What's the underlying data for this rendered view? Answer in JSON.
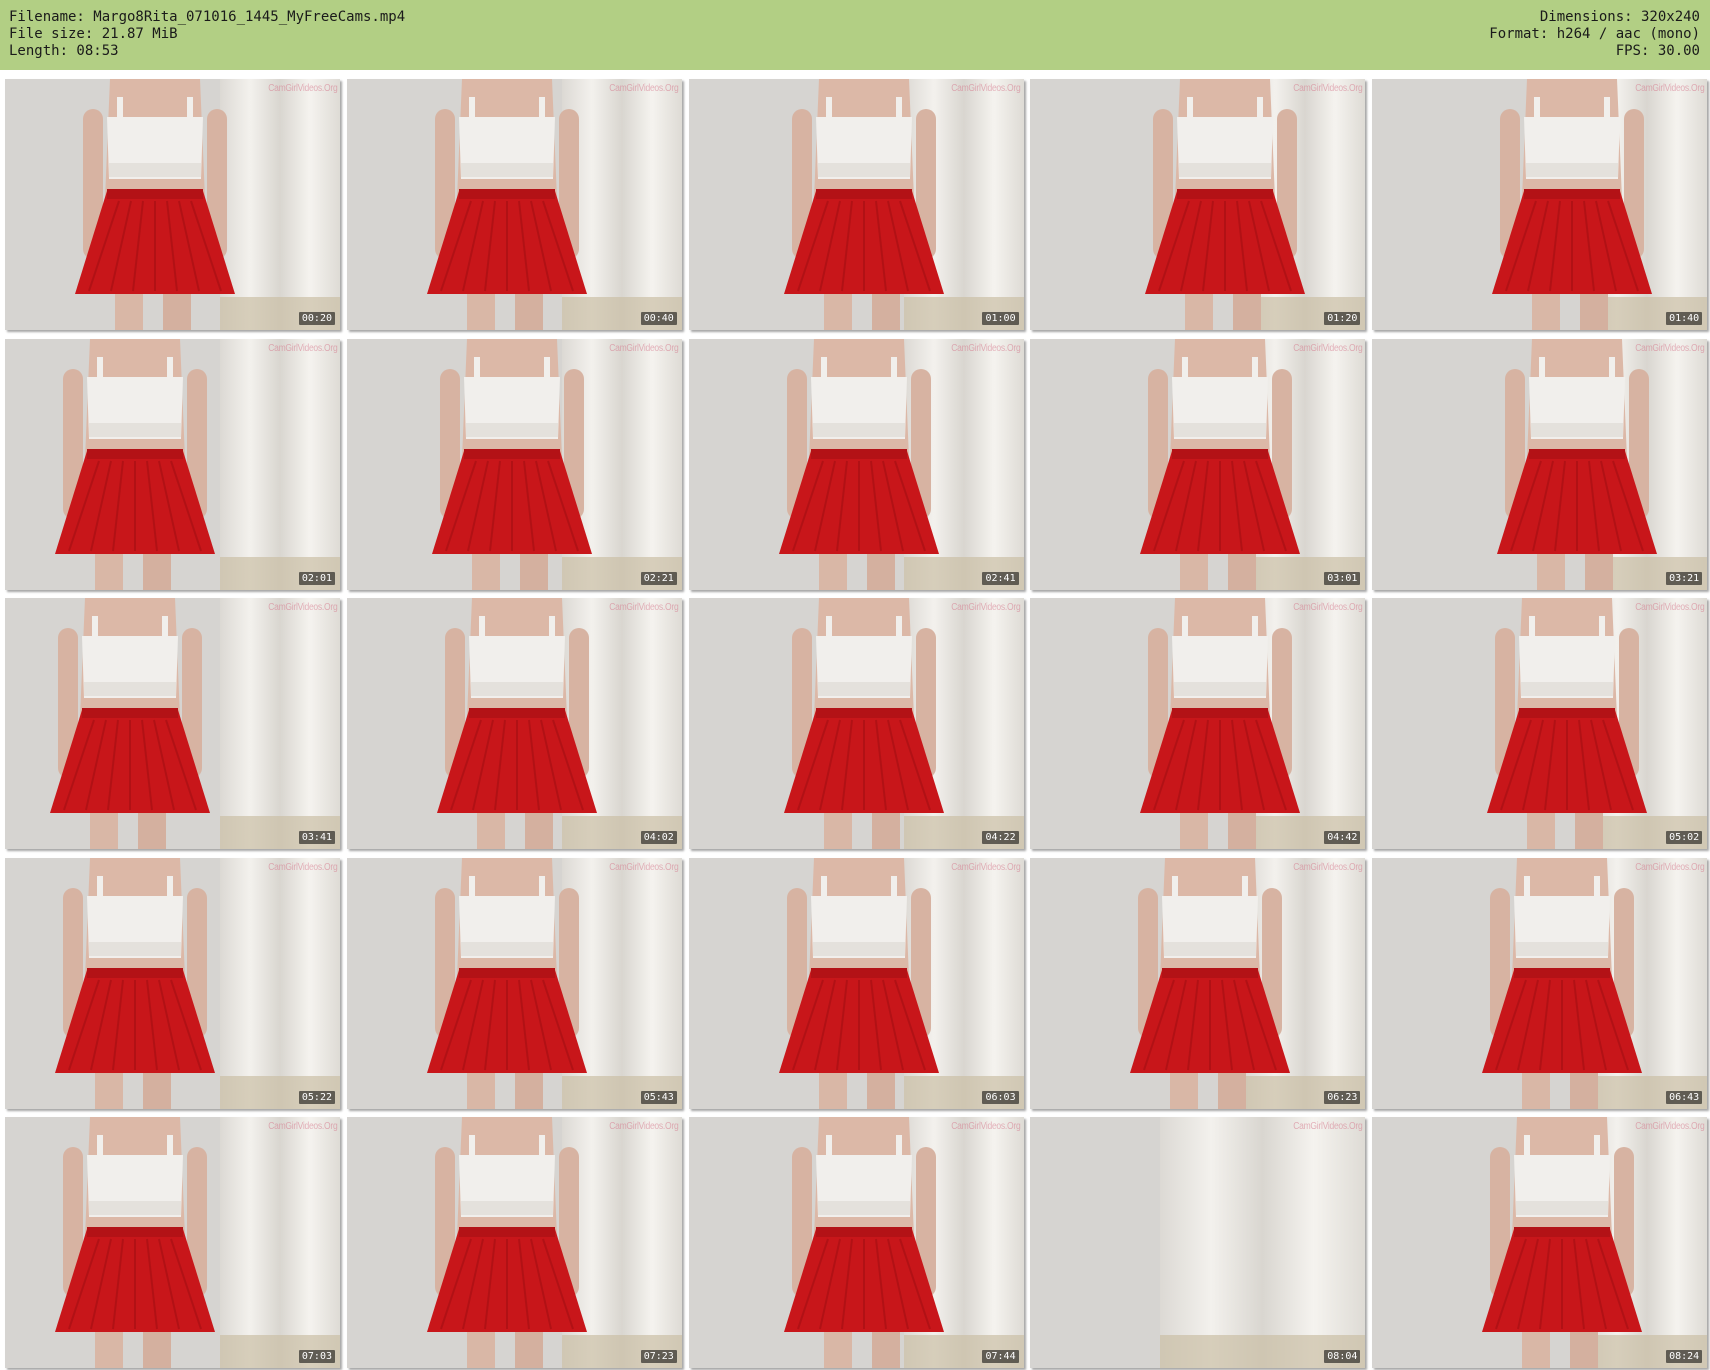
{
  "header": {
    "filename_line": "Filename: Margo8Rita_071016_1445_MyFreeCams.mp4",
    "filesize_line": "File size: 21.87 MiB",
    "length_line": "Length: 08:53",
    "dimensions_line": "Dimensions: 320x240",
    "format_line": "Format: h264 / aac (mono)",
    "fps_line": "FPS: 30.00"
  },
  "colors": {
    "header_bg": "#b2cf84",
    "skirt": "#c8161a",
    "top": "#f1efec",
    "wall": "#d6d4d1",
    "curtain": "#ece9e3"
  },
  "watermark": "CamGirlVideos.Org",
  "thumbnails": [
    {
      "time": "00:20",
      "pose": "person"
    },
    {
      "time": "00:40",
      "pose": "person"
    },
    {
      "time": "01:00",
      "pose": "person"
    },
    {
      "time": "01:20",
      "pose": "person"
    },
    {
      "time": "01:40",
      "pose": "person"
    },
    {
      "time": "02:01",
      "pose": "person"
    },
    {
      "time": "02:21",
      "pose": "person"
    },
    {
      "time": "02:41",
      "pose": "person"
    },
    {
      "time": "03:01",
      "pose": "person"
    },
    {
      "time": "03:21",
      "pose": "person"
    },
    {
      "time": "03:41",
      "pose": "person"
    },
    {
      "time": "04:02",
      "pose": "person"
    },
    {
      "time": "04:22",
      "pose": "person"
    },
    {
      "time": "04:42",
      "pose": "person"
    },
    {
      "time": "05:02",
      "pose": "person"
    },
    {
      "time": "05:22",
      "pose": "person"
    },
    {
      "time": "05:43",
      "pose": "person"
    },
    {
      "time": "06:03",
      "pose": "person"
    },
    {
      "time": "06:23",
      "pose": "person"
    },
    {
      "time": "06:43",
      "pose": "person"
    },
    {
      "time": "07:03",
      "pose": "person"
    },
    {
      "time": "07:23",
      "pose": "person"
    },
    {
      "time": "07:44",
      "pose": "person"
    },
    {
      "time": "08:04",
      "pose": "empty"
    },
    {
      "time": "08:24",
      "pose": "person"
    }
  ]
}
